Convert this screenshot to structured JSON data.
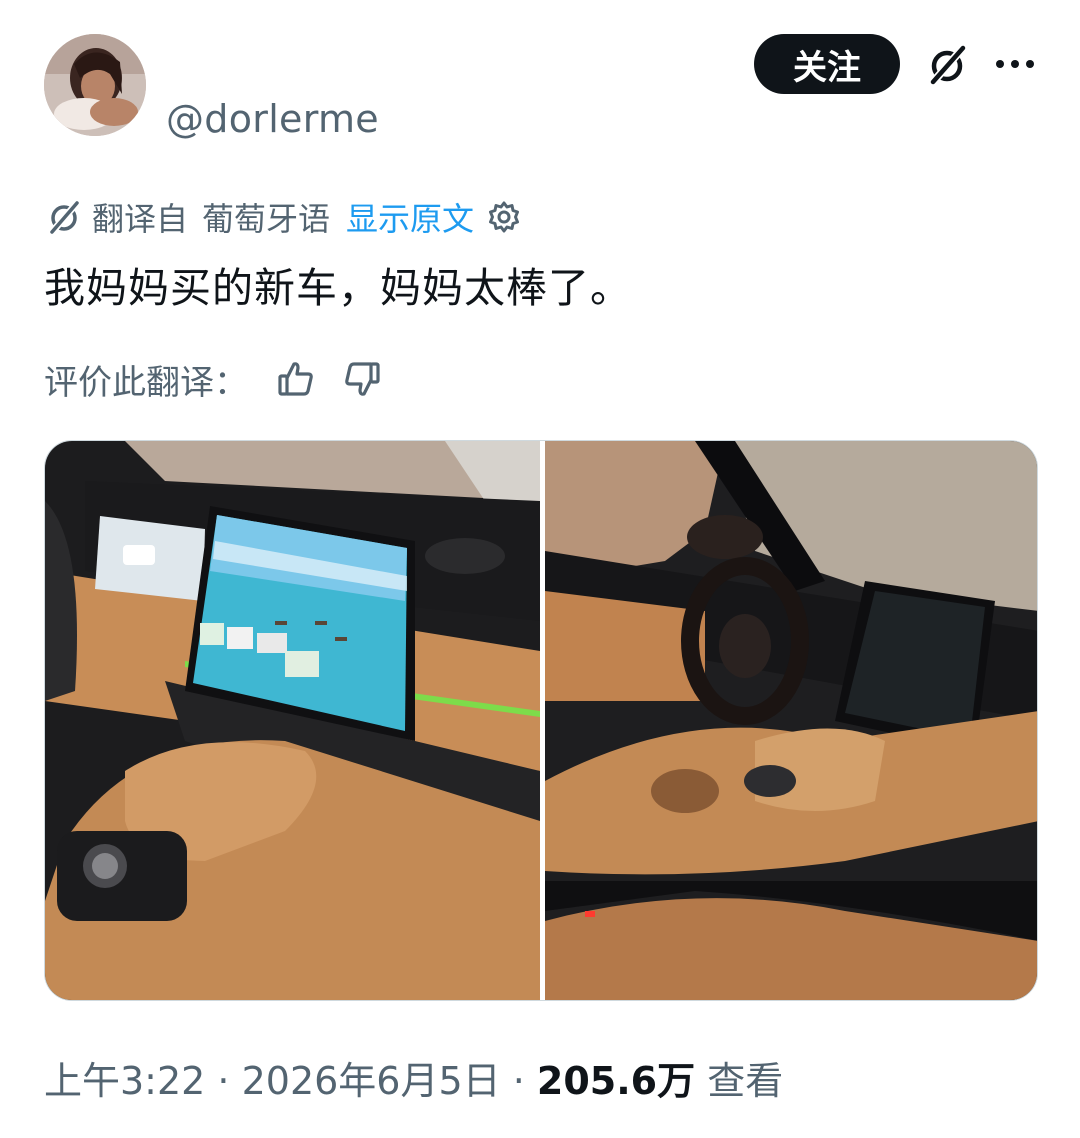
{
  "tweet": {
    "handle": "@dorlerme",
    "follow_label": "关注",
    "translation": {
      "prefix": "翻译自",
      "language": "葡萄牙语",
      "show_original": "显示原文"
    },
    "text": "我妈妈买的新车，妈妈太棒了。",
    "rate": {
      "label": "评价此翻译："
    },
    "meta": {
      "time": "上午3:22",
      "sep1": " · ",
      "date": "2026年6月5日",
      "sep2": " · ",
      "views_count": "205.6万",
      "views_label": " 查看"
    }
  },
  "colors": {
    "primary_text": "#0f1419",
    "secondary_text": "#536471",
    "link": "#1d9bf0",
    "follow_button_bg": "#0f1419",
    "follow_button_text": "#ffffff"
  },
  "icons": {
    "grok": "grok-slash-icon",
    "more": "ellipsis-icon",
    "translate": "grok-slash-icon",
    "settings": "gear-icon",
    "thumbs_up": "thumbs-up-icon",
    "thumbs_down": "thumbs-down-icon"
  }
}
